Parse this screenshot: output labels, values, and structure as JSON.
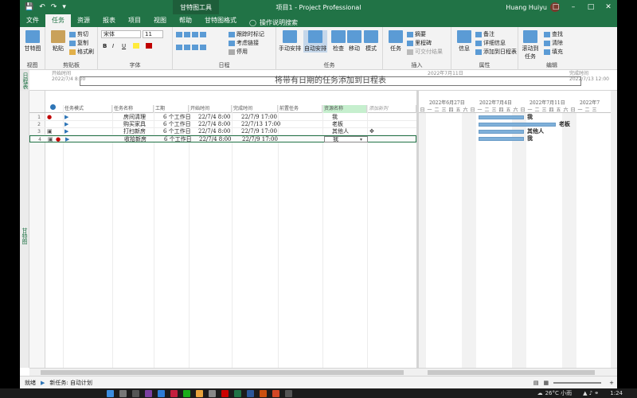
{
  "titlebar": {
    "context_tool": "甘特图工具",
    "doc_title": "项目1 - Project Professional",
    "user_name": "Huang Huiyu",
    "save_icon": "save-icon",
    "undo_icon": "undo-icon",
    "redo_icon": "redo-icon"
  },
  "tabs": [
    "文件",
    "任务",
    "资源",
    "报表",
    "项目",
    "视图",
    "帮助",
    "甘特图格式"
  ],
  "active_tab": "任务",
  "search_placeholder": "操作说明搜索",
  "ribbon": {
    "view": {
      "label": "视图",
      "gantt_btn": "甘特图"
    },
    "clipboard": {
      "label": "剪贴板",
      "paste": "粘贴",
      "cut": "剪切",
      "copy": "复制",
      "format_painter": "格式刷"
    },
    "font": {
      "label": "字体",
      "font_name": "宋体",
      "font_size": "11",
      "bold": "B",
      "italic": "I",
      "underline": "U"
    },
    "schedule": {
      "label": "日程",
      "mark_on_track": "跟踪时标记",
      "respect_links": "考虑链接",
      "inactivate": "停用"
    },
    "tasks": {
      "label": "任务",
      "manual": "手动安排",
      "auto": "自动安排",
      "inspect": "检查",
      "move": "移动",
      "mode": "模式"
    },
    "insert": {
      "label": "插入",
      "task": "任务",
      "summary": "摘要",
      "milestone": "里程碑",
      "deliverable": "可交付结果"
    },
    "properties": {
      "label": "属性",
      "info": "信息",
      "notes": "备注",
      "details": "详细信息",
      "add_timeline": "添加到日程表"
    },
    "editing": {
      "label": "编辑",
      "scroll_to": "滚动到任务",
      "find": "查找",
      "clear": "清除",
      "fill": "填充"
    }
  },
  "timeline": {
    "side_label": "日程表",
    "start_label": "开始时间",
    "start_value": "2022/7/4 8:00",
    "placeholder": "将带有日期的任务添加到日程表",
    "mid_date": "2022年7月11日",
    "finish_label": "完成时间",
    "finish_value": "2022/7/13 12:00"
  },
  "view_side_label": "甘特图",
  "grid": {
    "headers": [
      "任务模式",
      "任务名称",
      "工期",
      "开始时间",
      "完成时间",
      "前置任务",
      "资源名称",
      "添加新列"
    ],
    "rows": [
      {
        "num": "1",
        "name": "房间清理",
        "duration": "6 个工作日",
        "start": "22/7/4 8:00",
        "finish": "22/7/9 17:00",
        "pred": "",
        "resource": "我"
      },
      {
        "num": "2",
        "name": "购买家具",
        "duration": "6 个工作日",
        "start": "22/7/4 8:00",
        "finish": "22/7/13 17:00",
        "pred": "",
        "resource": "老板"
      },
      {
        "num": "3",
        "name": "打扫新房",
        "duration": "6 个工作日",
        "start": "22/7/4 8:00",
        "finish": "22/7/9 17:00",
        "pred": "",
        "resource": "其他人"
      },
      {
        "num": "4",
        "name": "收拾新房",
        "duration": "6 个工作日",
        "start": "22/7/4 8:00",
        "finish": "22/7/9 17:00",
        "pred": "",
        "resource": "我"
      }
    ]
  },
  "gantt": {
    "weeks": [
      "2022年6月27日",
      "2022年7月4日",
      "2022年7月11日",
      "2022年7"
    ],
    "days": [
      "日",
      "一",
      "二",
      "三",
      "四",
      "五",
      "六",
      "日",
      "一",
      "二",
      "三",
      "四",
      "五",
      "六",
      "日",
      "一",
      "二",
      "三",
      "四",
      "五",
      "六",
      "日",
      "一",
      "二",
      "三"
    ],
    "bar_labels": [
      "我",
      "老板",
      "其他人",
      "我"
    ]
  },
  "status": {
    "ready": "就绪",
    "new_tasks": "新任务: 自动计划"
  },
  "taskbar": {
    "weather": "26°C 小雨",
    "time": "1:24"
  }
}
